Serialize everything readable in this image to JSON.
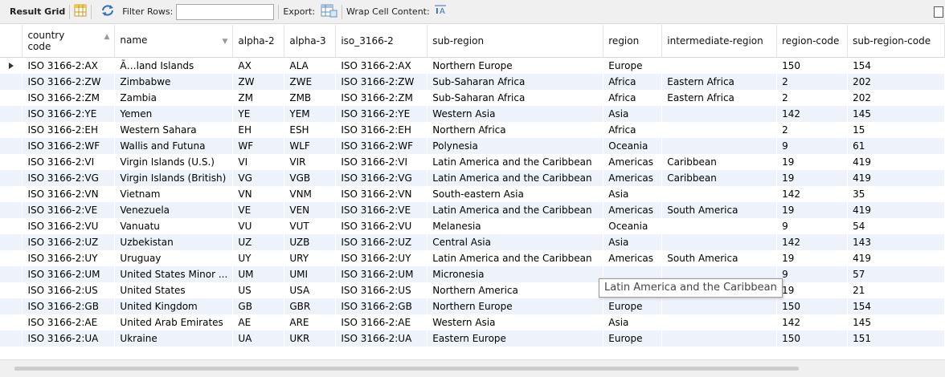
{
  "toolbar": {
    "result_grid": "Result Grid",
    "filter_rows": "Filter Rows:",
    "filter_value": "",
    "export": "Export:",
    "wrap": "Wrap Cell Content:",
    "icons": [
      "grid-icon",
      "refresh-icon",
      "export-icon",
      "wrap-icon",
      "panel-toggle-icon"
    ]
  },
  "table": {
    "headers": [
      "country code",
      "name",
      "alpha-2",
      "alpha-3",
      "iso_3166-2",
      "sub-region",
      "region",
      "intermediate-region",
      "region-code",
      "sub-region-code"
    ],
    "rows": [
      [
        "ISO 3166-2:AX",
        "Ã…land Islands",
        "AX",
        "ALA",
        "ISO 3166-2:AX",
        "Northern Europe",
        "Europe",
        "",
        "150",
        "154"
      ],
      [
        "ISO 3166-2:ZW",
        "Zimbabwe",
        "ZW",
        "ZWE",
        "ISO 3166-2:ZW",
        "Sub-Saharan Africa",
        "Africa",
        "Eastern Africa",
        "2",
        "202"
      ],
      [
        "ISO 3166-2:ZM",
        "Zambia",
        "ZM",
        "ZMB",
        "ISO 3166-2:ZM",
        "Sub-Saharan Africa",
        "Africa",
        "Eastern Africa",
        "2",
        "202"
      ],
      [
        "ISO 3166-2:YE",
        "Yemen",
        "YE",
        "YEM",
        "ISO 3166-2:YE",
        "Western Asia",
        "Asia",
        "",
        "142",
        "145"
      ],
      [
        "ISO 3166-2:EH",
        "Western Sahara",
        "EH",
        "ESH",
        "ISO 3166-2:EH",
        "Northern Africa",
        "Africa",
        "",
        "2",
        "15"
      ],
      [
        "ISO 3166-2:WF",
        "Wallis and Futuna",
        "WF",
        "WLF",
        "ISO 3166-2:WF",
        "Polynesia",
        "Oceania",
        "",
        "9",
        "61"
      ],
      [
        "ISO 3166-2:VI",
        "Virgin Islands (U.S.)",
        "VI",
        "VIR",
        "ISO 3166-2:VI",
        "Latin America and the Caribbean",
        "Americas",
        "Caribbean",
        "19",
        "419"
      ],
      [
        "ISO 3166-2:VG",
        "Virgin Islands (British)",
        "VG",
        "VGB",
        "ISO 3166-2:VG",
        "Latin America and the Caribbean",
        "Americas",
        "Caribbean",
        "19",
        "419"
      ],
      [
        "ISO 3166-2:VN",
        "Vietnam",
        "VN",
        "VNM",
        "ISO 3166-2:VN",
        "South-eastern Asia",
        "Asia",
        "",
        "142",
        "35"
      ],
      [
        "ISO 3166-2:VE",
        "Venezuela",
        "VE",
        "VEN",
        "ISO 3166-2:VE",
        "Latin America and the Caribbean",
        "Americas",
        "South America",
        "19",
        "419"
      ],
      [
        "ISO 3166-2:VU",
        "Vanuatu",
        "VU",
        "VUT",
        "ISO 3166-2:VU",
        "Melanesia",
        "Oceania",
        "",
        "9",
        "54"
      ],
      [
        "ISO 3166-2:UZ",
        "Uzbekistan",
        "UZ",
        "UZB",
        "ISO 3166-2:UZ",
        "Central Asia",
        "Asia",
        "",
        "142",
        "143"
      ],
      [
        "ISO 3166-2:UY",
        "Uruguay",
        "UY",
        "URY",
        "ISO 3166-2:UY",
        "Latin America and the Caribbean",
        "Americas",
        "South America",
        "19",
        "419"
      ],
      [
        "ISO 3166-2:UM",
        "United States Minor ...",
        "UM",
        "UMI",
        "ISO 3166-2:UM",
        "Micronesia",
        "",
        "",
        "9",
        "57"
      ],
      [
        "ISO 3166-2:US",
        "United States",
        "US",
        "USA",
        "ISO 3166-2:US",
        "Northern America",
        "Americas",
        "",
        "19",
        "21"
      ],
      [
        "ISO 3166-2:GB",
        "United Kingdom",
        "GB",
        "GBR",
        "ISO 3166-2:GB",
        "Northern Europe",
        "Europe",
        "",
        "150",
        "154"
      ],
      [
        "ISO 3166-2:AE",
        "United Arab Emirates",
        "AE",
        "ARE",
        "ISO 3166-2:AE",
        "Western Asia",
        "Asia",
        "",
        "142",
        "145"
      ],
      [
        "ISO 3166-2:UA",
        "Ukraine",
        "UA",
        "UKR",
        "ISO 3166-2:UA",
        "Eastern Europe",
        "Europe",
        "",
        "150",
        "151"
      ]
    ]
  },
  "tooltip": "Latin America and the Caribbean"
}
